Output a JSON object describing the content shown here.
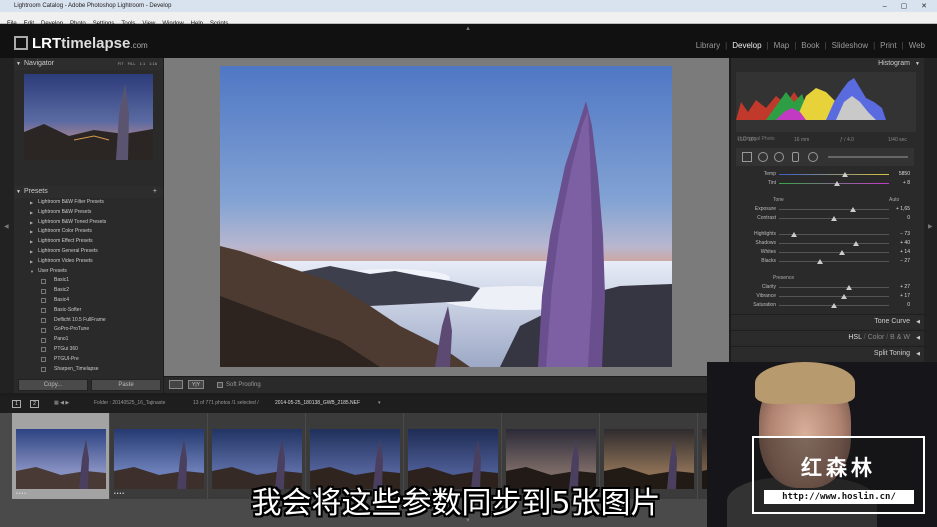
{
  "window": {
    "title": "Lightroom Catalog - Adobe Photoshop Lightroom - Develop",
    "controls": "– ▢ ✕"
  },
  "menu": [
    "File",
    "Edit",
    "Develop",
    "Photo",
    "Settings",
    "Tools",
    "View",
    "Window",
    "Help",
    "Scripts"
  ],
  "brand": {
    "prefix": "LRT",
    "name": "timelapse",
    ".com": ".com"
  },
  "modules": {
    "items": [
      "Library",
      "Develop",
      "Map",
      "Book",
      "Slideshow",
      "Print",
      "Web"
    ],
    "active": "Develop"
  },
  "navigator": {
    "title": "Navigator",
    "options": [
      "FIT",
      "FILL",
      "1:1",
      "1:16"
    ]
  },
  "presets": {
    "title": "Presets",
    "add": "+",
    "folders": [
      "Lightroom B&W Filter Presets",
      "Lightroom B&W Presets",
      "Lightroom B&W Toned Presets",
      "Lightroom Color Presets",
      "Lightroom Effect Presets",
      "Lightroom General Presets",
      "Lightroom Video Presets",
      "User Presets"
    ],
    "user": [
      "Basic1",
      "Basic2",
      "Basic4",
      "Basic-Softer",
      "Deflicht 10.5 FullFrame",
      "GoPro-ProTune",
      "Pano1",
      "PTGui 360",
      "PTGUI-Pre",
      "Sharpen_Timelapse"
    ]
  },
  "buttons": {
    "copy": "Copy...",
    "paste": "Paste"
  },
  "toolbar": {
    "soft_proofing": "Soft Proofing",
    "view_mode": "Y|Y"
  },
  "histogram": {
    "title": "Histogram",
    "iso": "ISO 100",
    "focal": "16 mm",
    "aperture": "ƒ / 4.0",
    "shutter": "1/40 sec",
    "original": "Original Photo"
  },
  "basic": {
    "tone_title": "Tone",
    "auto": "Auto",
    "presence_title": "Presence",
    "wb": [
      {
        "label": "Temp",
        "value": "5850",
        "pos": 0.6
      },
      {
        "label": "Tint",
        "value": "+ 8",
        "pos": 0.53
      }
    ],
    "tone": [
      {
        "label": "Exposure",
        "value": "+ 1,65",
        "pos": 0.67
      },
      {
        "label": "Contrast",
        "value": "0",
        "pos": 0.5
      }
    ],
    "tone2": [
      {
        "label": "Highlights",
        "value": "− 73",
        "pos": 0.14
      },
      {
        "label": "Shadows",
        "value": "+ 40",
        "pos": 0.7
      },
      {
        "label": "Whites",
        "value": "+ 14",
        "pos": 0.57
      },
      {
        "label": "Blacks",
        "value": "− 27",
        "pos": 0.37
      }
    ],
    "presence": [
      {
        "label": "Clarity",
        "value": "+ 27",
        "pos": 0.64
      },
      {
        "label": "Vibrance",
        "value": "+ 17",
        "pos": 0.59
      },
      {
        "label": "Saturation",
        "value": "0",
        "pos": 0.5
      }
    ]
  },
  "panels": {
    "tone_curve": "Tone Curve",
    "hsl": "HSL",
    "color": "Color",
    "bw": "B & W",
    "split": "Split Toning",
    "sep": "/"
  },
  "filmbar": {
    "page1": "1",
    "page2": "2",
    "folder": "Folder : 20140525_16_Tajinaste",
    "count": "13 of 771 photos /1 selected /",
    "file": "2014-05-25_180138_GWB_2185.NEF",
    "arrow": "▾"
  },
  "overlay": {
    "watermark_cn": "红森林",
    "watermark_url": "http://www.hoslin.cn/",
    "subtitle": "我会将这些参数同步到5张图片"
  }
}
